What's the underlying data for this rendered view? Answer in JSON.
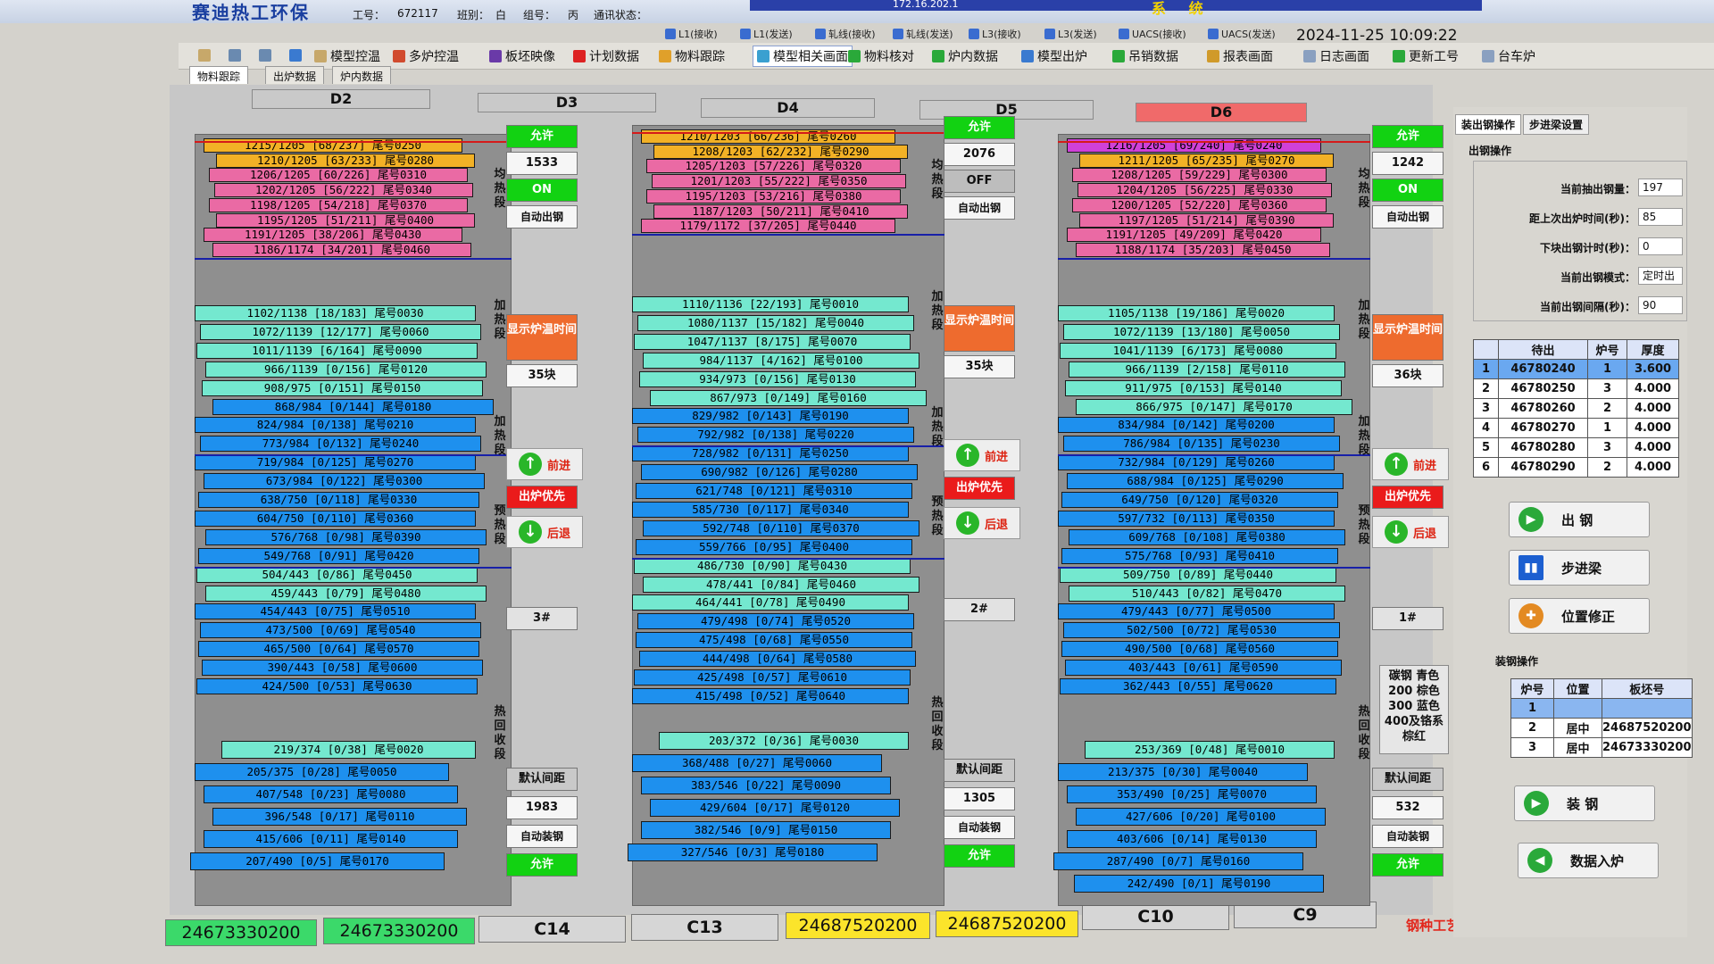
{
  "header": {
    "brand": "赛迪热工环保",
    "system_label": "系 统",
    "ip": "172.16.202.1",
    "work_id_label": "工号：",
    "work_id": "672117",
    "shift_label": "班别：",
    "shift": "白",
    "group_label": "组号：",
    "group": "丙",
    "comm_label": "通讯状态：",
    "datetime": "2024-11-25 10:09:22"
  },
  "status": [
    "L1(接收)",
    "L1(发送)",
    "轧线(接收)",
    "轧线(发送)",
    "L3(接收)",
    "L3(发送)",
    "UACS(接收)",
    "UACS(发送)"
  ],
  "toolbar": [
    "模型控温",
    "多炉控温",
    "板坯映像",
    "计划数据",
    "物料跟踪",
    "模型相关画面",
    "物料核对",
    "炉内数据",
    "模型出炉",
    "吊销数据",
    "报表画面",
    "日志画面",
    "更新工号",
    "台车炉"
  ],
  "tabs": [
    "物料跟踪",
    "出炉数据",
    "炉内数据"
  ],
  "furnace_headers": [
    "D2",
    "D3",
    "D4",
    "D5",
    "D6"
  ],
  "zones": {
    "soak": "均热段",
    "heat2": "加热段",
    "heat1": "加热段",
    "preheat": "预热段",
    "recovery": "热回收段"
  },
  "f1": {
    "slabs_top": [
      [
        "1215/1205 [68/237] 尾号0250",
        "orange"
      ],
      [
        "1210/1205 [63/233] 尾号0280",
        "orange"
      ],
      [
        "1206/1205 [60/226] 尾号0310",
        "pink"
      ],
      [
        "1202/1205 [56/222] 尾号0340",
        "pink"
      ],
      [
        "1198/1205 [54/218] 尾号0370",
        "pink"
      ],
      [
        "1195/1205 [51/211] 尾号0400",
        "pink"
      ],
      [
        "1191/1205 [38/206] 尾号0430",
        "pink"
      ],
      [
        "1186/1174 [34/201] 尾号0460",
        "pink"
      ]
    ],
    "slabs_mid": [
      [
        "1102/1138 [18/183] 尾号0030",
        "teal"
      ],
      [
        "1072/1139 [12/177] 尾号0060",
        "teal"
      ],
      [
        "1011/1139 [6/164] 尾号0090",
        "teal"
      ],
      [
        "966/1139 [0/156] 尾号0120",
        "teal"
      ],
      [
        "908/975 [0/151] 尾号0150",
        "teal"
      ],
      [
        "868/984 [0/144] 尾号0180",
        "blue"
      ],
      [
        "824/984 [0/138] 尾号0210",
        "blue"
      ],
      [
        "773/984 [0/132] 尾号0240",
        "blue"
      ],
      [
        "719/984 [0/125] 尾号0270",
        "blue"
      ],
      [
        "673/984 [0/122] 尾号0300",
        "blue"
      ],
      [
        "638/750 [0/118] 尾号0330",
        "blue"
      ],
      [
        "604/750 [0/110] 尾号0360",
        "blue"
      ],
      [
        "576/768 [0/98] 尾号0390",
        "blue"
      ],
      [
        "549/768 [0/91] 尾号0420",
        "blue"
      ],
      [
        "504/443 [0/86] 尾号0450",
        "teal"
      ],
      [
        "459/443 [0/79] 尾号0480",
        "teal"
      ],
      [
        "454/443 [0/75] 尾号0510",
        "blue"
      ],
      [
        "473/500 [0/69] 尾号0540",
        "blue"
      ],
      [
        "465/500 [0/64] 尾号0570",
        "blue"
      ],
      [
        "390/443 [0/58] 尾号0600",
        "blue"
      ],
      [
        "424/500 [0/53] 尾号0630",
        "blue"
      ]
    ],
    "slabs_bot": [
      [
        "219/374 [0/38] 尾号0020",
        "teal"
      ],
      [
        "205/375 [0/28] 尾号0050",
        "blue"
      ],
      [
        "407/548 [0/23] 尾号0080",
        "blue"
      ],
      [
        "396/548 [0/17] 尾号0110",
        "blue"
      ],
      [
        "415/606 [0/11] 尾号0140",
        "blue"
      ],
      [
        "207/490 [0/5] 尾号0170",
        "blue"
      ]
    ],
    "ctrl": {
      "allow_top": "允许",
      "num": "1533",
      "mode": "ON",
      "auto_out": "自动出钢",
      "show_time": "显示炉温时间",
      "count": "35块",
      "forward": "前进",
      "priority": "出炉优先",
      "back": "后退",
      "furnace_no": "3#",
      "default_gap": "默认间距",
      "gap": "1983",
      "auto_in": "自动装钢",
      "allow_bot": "允许"
    }
  },
  "f2": {
    "slabs_top": [
      [
        "1210/1203 [66/236] 尾号0260",
        "orange"
      ],
      [
        "1208/1203 [62/232] 尾号0290",
        "orange"
      ],
      [
        "1205/1203 [57/226] 尾号0320",
        "pink"
      ],
      [
        "1201/1203 [55/222] 尾号0350",
        "pink"
      ],
      [
        "1195/1203 [53/216] 尾号0380",
        "pink"
      ],
      [
        "1187/1203 [50/211] 尾号0410",
        "pink"
      ],
      [
        "1179/1172 [37/205] 尾号0440",
        "pink"
      ]
    ],
    "slabs_mid": [
      [
        "1110/1136 [22/193] 尾号0010",
        "teal"
      ],
      [
        "1080/1137 [15/182] 尾号0040",
        "teal"
      ],
      [
        "1047/1137 [8/175] 尾号0070",
        "teal"
      ],
      [
        "984/1137 [4/162] 尾号0100",
        "teal"
      ],
      [
        "934/973 [0/156] 尾号0130",
        "teal"
      ],
      [
        "867/973 [0/149] 尾号0160",
        "teal"
      ],
      [
        "829/982 [0/143] 尾号0190",
        "blue"
      ],
      [
        "792/982 [0/138] 尾号0220",
        "blue"
      ],
      [
        "728/982 [0/131] 尾号0250",
        "blue"
      ],
      [
        "690/982 [0/126] 尾号0280",
        "blue"
      ],
      [
        "621/748 [0/121] 尾号0310",
        "blue"
      ],
      [
        "585/730 [0/117] 尾号0340",
        "blue"
      ],
      [
        "592/748 [0/110] 尾号0370",
        "blue"
      ],
      [
        "559/766 [0/95] 尾号0400",
        "blue"
      ],
      [
        "486/730 [0/90] 尾号0430",
        "teal"
      ],
      [
        "478/441 [0/84] 尾号0460",
        "teal"
      ],
      [
        "464/441 [0/78] 尾号0490",
        "teal"
      ],
      [
        "479/498 [0/74] 尾号0520",
        "blue"
      ],
      [
        "475/498 [0/68] 尾号0550",
        "blue"
      ],
      [
        "444/498 [0/64] 尾号0580",
        "blue"
      ],
      [
        "425/498 [0/57] 尾号0610",
        "blue"
      ],
      [
        "415/498 [0/52] 尾号0640",
        "blue"
      ]
    ],
    "slabs_bot": [
      [
        "203/372 [0/36] 尾号0030",
        "teal"
      ],
      [
        "368/488 [0/27] 尾号0060",
        "blue"
      ],
      [
        "383/546 [0/22] 尾号0090",
        "blue"
      ],
      [
        "429/604 [0/17] 尾号0120",
        "blue"
      ],
      [
        "382/546 [0/9] 尾号0150",
        "blue"
      ],
      [
        "327/546 [0/3] 尾号0180",
        "blue"
      ]
    ],
    "ctrl": {
      "allow_top": "允许",
      "num": "2076",
      "mode": "OFF",
      "auto_out": "自动出钢",
      "show_time": "显示炉温时间",
      "count": "35块",
      "forward": "前进",
      "priority": "出炉优先",
      "back": "后退",
      "furnace_no": "2#",
      "default_gap": "默认间距",
      "gap": "1305",
      "auto_in": "自动装钢",
      "allow_bot": "允许"
    }
  },
  "f3": {
    "slabs_top": [
      [
        "1216/1205 [69/240] 尾号0240",
        "mag"
      ],
      [
        "1211/1205 [65/235] 尾号0270",
        "orange"
      ],
      [
        "1208/1205 [59/229] 尾号0300",
        "pink"
      ],
      [
        "1204/1205 [56/225] 尾号0330",
        "pink"
      ],
      [
        "1200/1205 [52/220] 尾号0360",
        "pink"
      ],
      [
        "1197/1205 [51/214] 尾号0390",
        "pink"
      ],
      [
        "1191/1205 [49/209] 尾号0420",
        "pink"
      ],
      [
        "1188/1174 [35/203] 尾号0450",
        "pink"
      ]
    ],
    "slabs_mid": [
      [
        "1105/1138 [19/186] 尾号0020",
        "teal"
      ],
      [
        "1072/1139 [13/180] 尾号0050",
        "teal"
      ],
      [
        "1041/1139 [6/173] 尾号0080",
        "teal"
      ],
      [
        "966/1139 [2/158] 尾号0110",
        "teal"
      ],
      [
        "911/975 [0/153] 尾号0140",
        "teal"
      ],
      [
        "866/975 [0/147] 尾号0170",
        "teal"
      ],
      [
        "834/984 [0/142] 尾号0200",
        "blue"
      ],
      [
        "786/984 [0/135] 尾号0230",
        "blue"
      ],
      [
        "732/984 [0/129] 尾号0260",
        "blue"
      ],
      [
        "688/984 [0/125] 尾号0290",
        "blue"
      ],
      [
        "649/750 [0/120] 尾号0320",
        "blue"
      ],
      [
        "597/732 [0/113] 尾号0350",
        "blue"
      ],
      [
        "609/768 [0/108] 尾号0380",
        "blue"
      ],
      [
        "575/768 [0/93] 尾号0410",
        "blue"
      ],
      [
        "509/750 [0/89] 尾号0440",
        "teal"
      ],
      [
        "510/443 [0/82] 尾号0470",
        "teal"
      ],
      [
        "479/443 [0/77] 尾号0500",
        "blue"
      ],
      [
        "502/500 [0/72] 尾号0530",
        "blue"
      ],
      [
        "490/500 [0/68] 尾号0560",
        "blue"
      ],
      [
        "403/443 [0/61] 尾号0590",
        "blue"
      ],
      [
        "362/443 [0/55] 尾号0620",
        "blue"
      ]
    ],
    "slabs_bot": [
      [
        "253/369 [0/48] 尾号0010",
        "teal"
      ],
      [
        "213/375 [0/30] 尾号0040",
        "blue"
      ],
      [
        "353/490 [0/25] 尾号0070",
        "blue"
      ],
      [
        "427/606 [0/20] 尾号0100",
        "blue"
      ],
      [
        "403/606 [0/14] 尾号0130",
        "blue"
      ],
      [
        "287/490 [0/7] 尾号0160",
        "blue"
      ],
      [
        "242/490 [0/1] 尾号0190",
        "blue"
      ]
    ],
    "ctrl": {
      "allow_top": "允许",
      "num": "1242",
      "mode": "ON",
      "auto_out": "自动出钢",
      "show_time": "显示炉温时间",
      "count": "36块",
      "forward": "前进",
      "priority": "出炉优先",
      "back": "后退",
      "furnace_no": "1#",
      "default_gap": "默认间距",
      "gap": "532",
      "auto_in": "自动装钢",
      "allow_bot": "允许"
    }
  },
  "legend": [
    "碳钢 青色",
    "200 棕色",
    "300 蓝色",
    "400及铬系",
    "棕红"
  ],
  "bottom": [
    "24673330200",
    "24673330200",
    "C14",
    "C13",
    "24687520200",
    "24687520200",
    "C10",
    "C9"
  ],
  "steel_label": "钢种工艺:",
  "right": {
    "tabs": [
      "装出钢操作",
      "步进梁设置"
    ],
    "section1": "出钢操作",
    "fields": [
      [
        "当前抽出钢量：",
        "197"
      ],
      [
        "距上次出炉时间(秒)：",
        "85"
      ],
      [
        "下块出钢计时(秒)：",
        "0"
      ],
      [
        "当前出钢模式：",
        "定时出"
      ],
      [
        "当前出钢间隔(秒)：",
        "90"
      ]
    ],
    "queue_headers": [
      "",
      "待出",
      "炉号",
      "厚度"
    ],
    "queue": [
      [
        "1",
        "46780240",
        "1",
        "3.600"
      ],
      [
        "2",
        "46780250",
        "3",
        "4.000"
      ],
      [
        "3",
        "46780260",
        "2",
        "4.000"
      ],
      [
        "4",
        "46780270",
        "1",
        "4.000"
      ],
      [
        "5",
        "46780280",
        "3",
        "4.000"
      ],
      [
        "6",
        "46780290",
        "2",
        "4.000"
      ]
    ],
    "btn_out": "出 钢",
    "btn_step": "步进梁",
    "btn_pos": "位置修正",
    "section2": "装钢操作",
    "load_headers": [
      "炉号",
      "位置",
      "板坯号"
    ],
    "load": [
      [
        "1",
        "",
        ""
      ],
      [
        "2",
        "居中",
        "24687520200"
      ],
      [
        "3",
        "居中",
        "24673330200"
      ]
    ],
    "btn_load": "装 钢",
    "btn_data": "数据入炉"
  }
}
